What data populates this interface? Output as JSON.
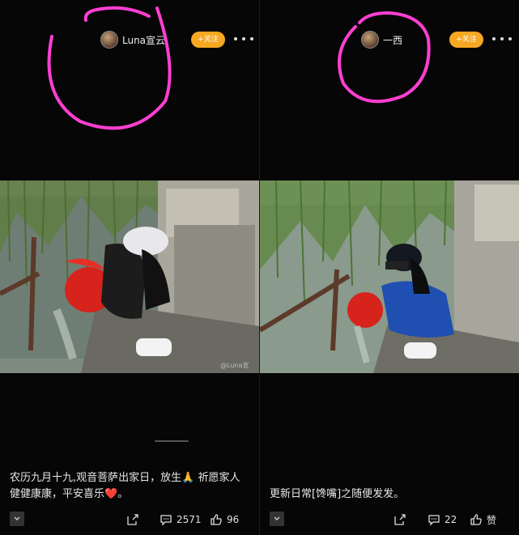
{
  "left_post": {
    "author": "Luna宣云",
    "follow_label": "+关注",
    "watermark": "@Luna宣",
    "caption_line1": "农历九月十九,观音菩萨出家日，放生",
    "prayer_emoji": "🙏",
    "caption_line1b": " 祈愿家人",
    "caption_line2": "健健康康，平安喜乐",
    "heart_emoji": "❤️",
    "caption_end": "。",
    "comments_count": "2571",
    "likes_count": "96"
  },
  "right_post": {
    "author": "一西",
    "follow_label": "+关注",
    "caption": "更新日常[馋嘴]之随便发发。",
    "comments_count": "22",
    "likes_label": "赞"
  },
  "icons": [
    "avatar",
    "more-dots-icon",
    "collapse-chevron-icon",
    "share-icon",
    "comment-icon",
    "like-thumb-icon"
  ],
  "colors": {
    "follow_button": "#f7a823",
    "annotation_circle": "#ff3fd2",
    "background": "#060606"
  }
}
